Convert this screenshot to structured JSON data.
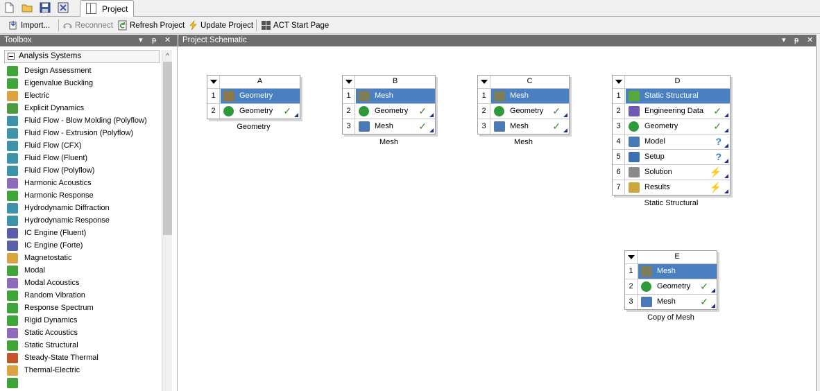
{
  "tabs": {
    "project_label": "Project"
  },
  "toolbar": {
    "import_label": "Import...",
    "reconnect_label": "Reconnect",
    "refresh_label": "Refresh Project",
    "update_label": "Update Project",
    "act_label": "ACT Start Page"
  },
  "toolbox": {
    "title": "Toolbox",
    "group_label": "Analysis Systems",
    "items": [
      {
        "label": "Design Assessment",
        "icon": "check-icon",
        "color": "#3fa43a"
      },
      {
        "label": "Eigenvalue Buckling",
        "icon": "buckling-icon",
        "color": "#3fa43a"
      },
      {
        "label": "Electric",
        "icon": "electric-icon",
        "color": "#d9a441"
      },
      {
        "label": "Explicit Dynamics",
        "icon": "explicit-icon",
        "color": "#4c9a3e"
      },
      {
        "label": "Fluid Flow - Blow Molding (Polyflow)",
        "icon": "fluid-icon",
        "color": "#3f93a8"
      },
      {
        "label": "Fluid Flow - Extrusion (Polyflow)",
        "icon": "fluid-icon",
        "color": "#3f93a8"
      },
      {
        "label": "Fluid Flow (CFX)",
        "icon": "fluid-icon",
        "color": "#3f93a8"
      },
      {
        "label": "Fluid Flow (Fluent)",
        "icon": "fluid-icon",
        "color": "#3f93a8"
      },
      {
        "label": "Fluid Flow (Polyflow)",
        "icon": "fluid-icon",
        "color": "#3f93a8"
      },
      {
        "label": "Harmonic Acoustics",
        "icon": "acoustics-icon",
        "color": "#8e6bb8"
      },
      {
        "label": "Harmonic Response",
        "icon": "harmonic-icon",
        "color": "#3fa43a"
      },
      {
        "label": "Hydrodynamic Diffraction",
        "icon": "hydro-icon",
        "color": "#3f93a8"
      },
      {
        "label": "Hydrodynamic Response",
        "icon": "hydro-icon",
        "color": "#3f93a8"
      },
      {
        "label": "IC Engine (Fluent)",
        "icon": "engine-icon",
        "color": "#5a5fa8"
      },
      {
        "label": "IC Engine (Forte)",
        "icon": "engine-icon",
        "color": "#5a5fa8"
      },
      {
        "label": "Magnetostatic",
        "icon": "magnet-icon",
        "color": "#d9a441"
      },
      {
        "label": "Modal",
        "icon": "modal-icon",
        "color": "#3fa43a"
      },
      {
        "label": "Modal Acoustics",
        "icon": "acoustics-icon",
        "color": "#8e6bb8"
      },
      {
        "label": "Random Vibration",
        "icon": "vibration-icon",
        "color": "#3fa43a"
      },
      {
        "label": "Response Spectrum",
        "icon": "spectrum-icon",
        "color": "#3fa43a"
      },
      {
        "label": "Rigid Dynamics",
        "icon": "rigid-icon",
        "color": "#3fa43a"
      },
      {
        "label": "Static Acoustics",
        "icon": "acoustics-icon",
        "color": "#8e6bb8"
      },
      {
        "label": "Static Structural",
        "icon": "static-icon",
        "color": "#3fa43a"
      },
      {
        "label": "Steady-State Thermal",
        "icon": "thermal-icon",
        "color": "#c0562a"
      },
      {
        "label": "Thermal-Electric",
        "icon": "thermal-electric-icon",
        "color": "#d9a441"
      },
      {
        "label": "",
        "icon": "transient-icon",
        "color": "#3fa43a"
      }
    ]
  },
  "schematic": {
    "title": "Project Schematic",
    "systems": [
      {
        "id": "A",
        "caption": "Geometry",
        "cells": [
          {
            "num": "1",
            "label": "Geometry",
            "icon": "geometry-icon",
            "status": "",
            "selected": true
          },
          {
            "num": "2",
            "label": "Geometry",
            "icon": "designmodeler-icon",
            "status": "ok",
            "selected": false
          }
        ]
      },
      {
        "id": "B",
        "caption": "Mesh",
        "cells": [
          {
            "num": "1",
            "label": "Mesh",
            "icon": "mesh-system-icon",
            "status": "",
            "selected": true
          },
          {
            "num": "2",
            "label": "Geometry",
            "icon": "designmodeler-icon",
            "status": "ok",
            "selected": false
          },
          {
            "num": "3",
            "label": "Mesh",
            "icon": "mesh-icon",
            "status": "ok",
            "selected": false
          }
        ]
      },
      {
        "id": "C",
        "caption": "Mesh",
        "cells": [
          {
            "num": "1",
            "label": "Mesh",
            "icon": "mesh-system-icon",
            "status": "",
            "selected": true
          },
          {
            "num": "2",
            "label": "Geometry",
            "icon": "designmodeler-icon",
            "status": "ok",
            "selected": false
          },
          {
            "num": "3",
            "label": "Mesh",
            "icon": "mesh-icon",
            "status": "ok",
            "selected": false
          }
        ]
      },
      {
        "id": "D",
        "caption": "Static Structural",
        "cells": [
          {
            "num": "1",
            "label": "Static Structural",
            "icon": "static-structural-icon",
            "status": "",
            "selected": true
          },
          {
            "num": "2",
            "label": "Engineering Data",
            "icon": "engineering-data-icon",
            "status": "ok",
            "selected": false
          },
          {
            "num": "3",
            "label": "Geometry",
            "icon": "designmodeler-icon",
            "status": "ok",
            "selected": false
          },
          {
            "num": "4",
            "label": "Model",
            "icon": "model-icon",
            "status": "question",
            "selected": false
          },
          {
            "num": "5",
            "label": "Setup",
            "icon": "setup-icon",
            "status": "question",
            "selected": false
          },
          {
            "num": "6",
            "label": "Solution",
            "icon": "solution-icon",
            "status": "bolt",
            "selected": false
          },
          {
            "num": "7",
            "label": "Results",
            "icon": "results-icon",
            "status": "bolt",
            "selected": false
          }
        ]
      },
      {
        "id": "E",
        "caption": "Copy of Mesh",
        "cells": [
          {
            "num": "1",
            "label": "Mesh",
            "icon": "mesh-system-icon",
            "status": "",
            "selected": true
          },
          {
            "num": "2",
            "label": "Geometry",
            "icon": "designmodeler-icon",
            "status": "ok",
            "selected": false
          },
          {
            "num": "3",
            "label": "Mesh",
            "icon": "mesh-icon",
            "status": "ok",
            "selected": false
          }
        ]
      }
    ]
  },
  "colors": {
    "selection": "#4a7fc1",
    "pane_header": "#6e6e6e",
    "status_ok": "#3a8a2a",
    "status_question": "#2a7fd4",
    "status_bolt": "#e0b000"
  }
}
